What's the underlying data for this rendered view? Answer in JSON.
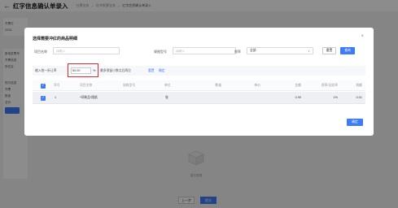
{
  "header": {
    "title": "红字信息确认单录入",
    "breadcrumbs": [
      "分票业务",
      "红冲发票业务",
      "红字信息确认单录入"
    ]
  },
  "background": {
    "field_labels": [
      "开票日",
      "2025-",
      "数电发票号",
      "开票信息",
      "所在区",
      "购方信息",
      "开票",
      "数量",
      "总价"
    ],
    "empty_text": "暂无数据",
    "prev_label": "上一步",
    "next_label": "提交"
  },
  "modal": {
    "title": "选择需要冲红的商品明细",
    "close_icon": "close-icon",
    "filters": {
      "item_name_label": "项目名称",
      "item_name_placeholder": "请输入",
      "spec_label": "规格型号",
      "spec_placeholder": "请输入",
      "tax_rate_label": "税率",
      "tax_rate_value": "全部",
      "reset_label": "重置",
      "query_label": "查询"
    },
    "rate_bar": {
      "label": "输入统一折让率",
      "value": "50.00",
      "unit": "%",
      "hint": "最多保留小数点后两位",
      "reset_link": "重置",
      "confirm_link": "确定"
    },
    "table": {
      "columns": [
        "序号",
        "项目名称",
        "规格型号",
        "单位",
        "数量",
        "单价",
        "金额",
        "税率/征收率",
        "税额"
      ],
      "rows": [
        {
          "index": "1",
          "name": "*印刷品*图纸",
          "spec": "",
          "unit": "张",
          "quantity": "",
          "price": "",
          "amount": "0.99",
          "tax_rate": "1%",
          "tax": "0.01"
        }
      ]
    },
    "ok_label": "确定"
  },
  "colors": {
    "primary": "#3c7cf6",
    "highlight": "#e0282e"
  }
}
